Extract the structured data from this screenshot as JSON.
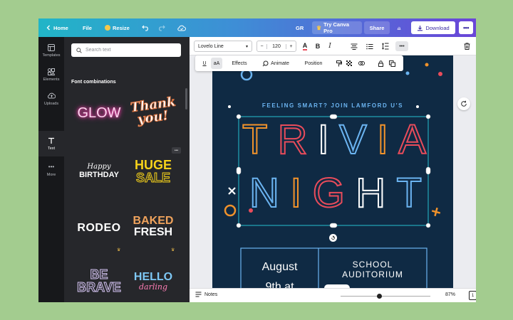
{
  "topbar": {
    "home": "Home",
    "file": "File",
    "resize": "Resize",
    "initials": "GR",
    "try_pro": "Try Canva Pro",
    "share": "Share",
    "download": "Download",
    "more": "•••"
  },
  "rail": {
    "items": [
      {
        "label": "Templates",
        "icon": "templates-icon"
      },
      {
        "label": "Elements",
        "icon": "elements-icon"
      },
      {
        "label": "Uploads",
        "icon": "uploads-icon"
      },
      {
        "label": "Text",
        "icon": "text-icon"
      },
      {
        "label": "More",
        "icon": "more-icon"
      }
    ]
  },
  "panel": {
    "search_placeholder": "Search text",
    "section_title": "Font combinations",
    "more": "•••",
    "cards": [
      {
        "line1": "GLOW",
        "line2": ""
      },
      {
        "line1": "Thank",
        "line2": "you!"
      },
      {
        "line1": "Happy",
        "line2": "BIRTHDAY"
      },
      {
        "line1": "HUGE",
        "line2": "SALE"
      },
      {
        "line1": "RODEO",
        "line2": ""
      },
      {
        "line1": "BAKED",
        "line2": "FRESH"
      },
      {
        "line1": "BE",
        "line2": "BRAVE"
      },
      {
        "line1": "HELLO",
        "line2": "darling"
      }
    ],
    "crown_icon": "crown-icon"
  },
  "toolbar": {
    "font": "Lovelo Line",
    "size": "120",
    "minus": "−",
    "plus": "+",
    "more": "•••"
  },
  "context": {
    "underline": "U",
    "case": "aA",
    "effects": "Effects",
    "animate": "Animate",
    "position": "Position"
  },
  "poster": {
    "tagline": "FEELING SMART? JOIN LAMFORD U'S",
    "title_line1": [
      "T",
      "R",
      "I",
      "V",
      "I",
      "A"
    ],
    "title_line2": [
      "N",
      "I",
      "G",
      "H",
      "T"
    ],
    "date_line1": "August",
    "date_line2": "9th at",
    "venue_line1": "SCHOOL",
    "venue_line2": "AUDITORIUM"
  },
  "bottombar": {
    "notes": "Notes",
    "zoom": "87%",
    "page": "1",
    "help": "?"
  },
  "colors": {
    "poster_bg": "#0f2a44",
    "orange": "#f0922b",
    "red": "#e94c5b",
    "blue": "#6bb4f1",
    "white": "#ffffff",
    "selection": "#26c0d0"
  }
}
